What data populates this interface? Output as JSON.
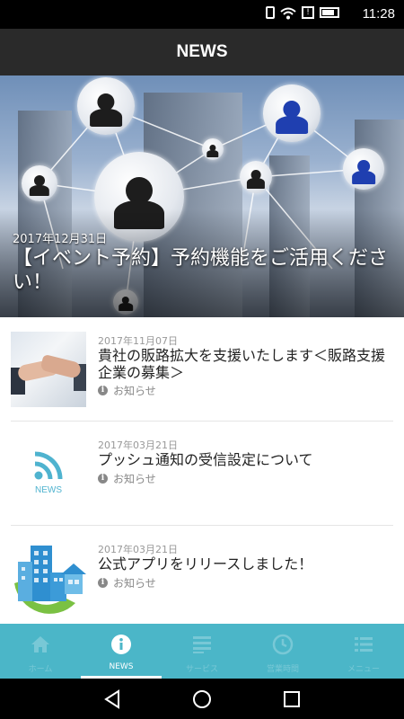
{
  "status_bar": {
    "time": "11:28"
  },
  "header": {
    "title": "NEWS"
  },
  "featured": {
    "date": "2017年12月31日",
    "title": "【イベント予約】予約機能をご活用ください！"
  },
  "news_items": [
    {
      "date": "2017年11月07日",
      "title": "貴社の販路拡大を支援いたします＜販路支援企業の募集＞",
      "category": "お知らせ",
      "thumb": "handshake-image"
    },
    {
      "date": "2017年03月21日",
      "title": "プッシュ通知の受信設定について",
      "category": "お知らせ",
      "thumb": "rss-news-icon",
      "thumb_label": "NEWS"
    },
    {
      "date": "2017年03月21日",
      "title": "公式アプリをリリースしました！",
      "category": "お知らせ",
      "thumb": "city-buildings-image"
    }
  ],
  "tabs": [
    {
      "label": "ホーム",
      "icon": "home-icon",
      "active": false
    },
    {
      "label": "NEWS",
      "icon": "info-icon",
      "active": true
    },
    {
      "label": "サービス",
      "icon": "menu-list-icon",
      "active": false
    },
    {
      "label": "営業時間",
      "icon": "clock-icon",
      "active": false
    },
    {
      "label": "メニュー",
      "icon": "list-icon",
      "active": false
    }
  ],
  "colors": {
    "tabbar": "#4bb6c8",
    "header": "#2a2a2a",
    "accent_news": "#4fb3cf"
  }
}
